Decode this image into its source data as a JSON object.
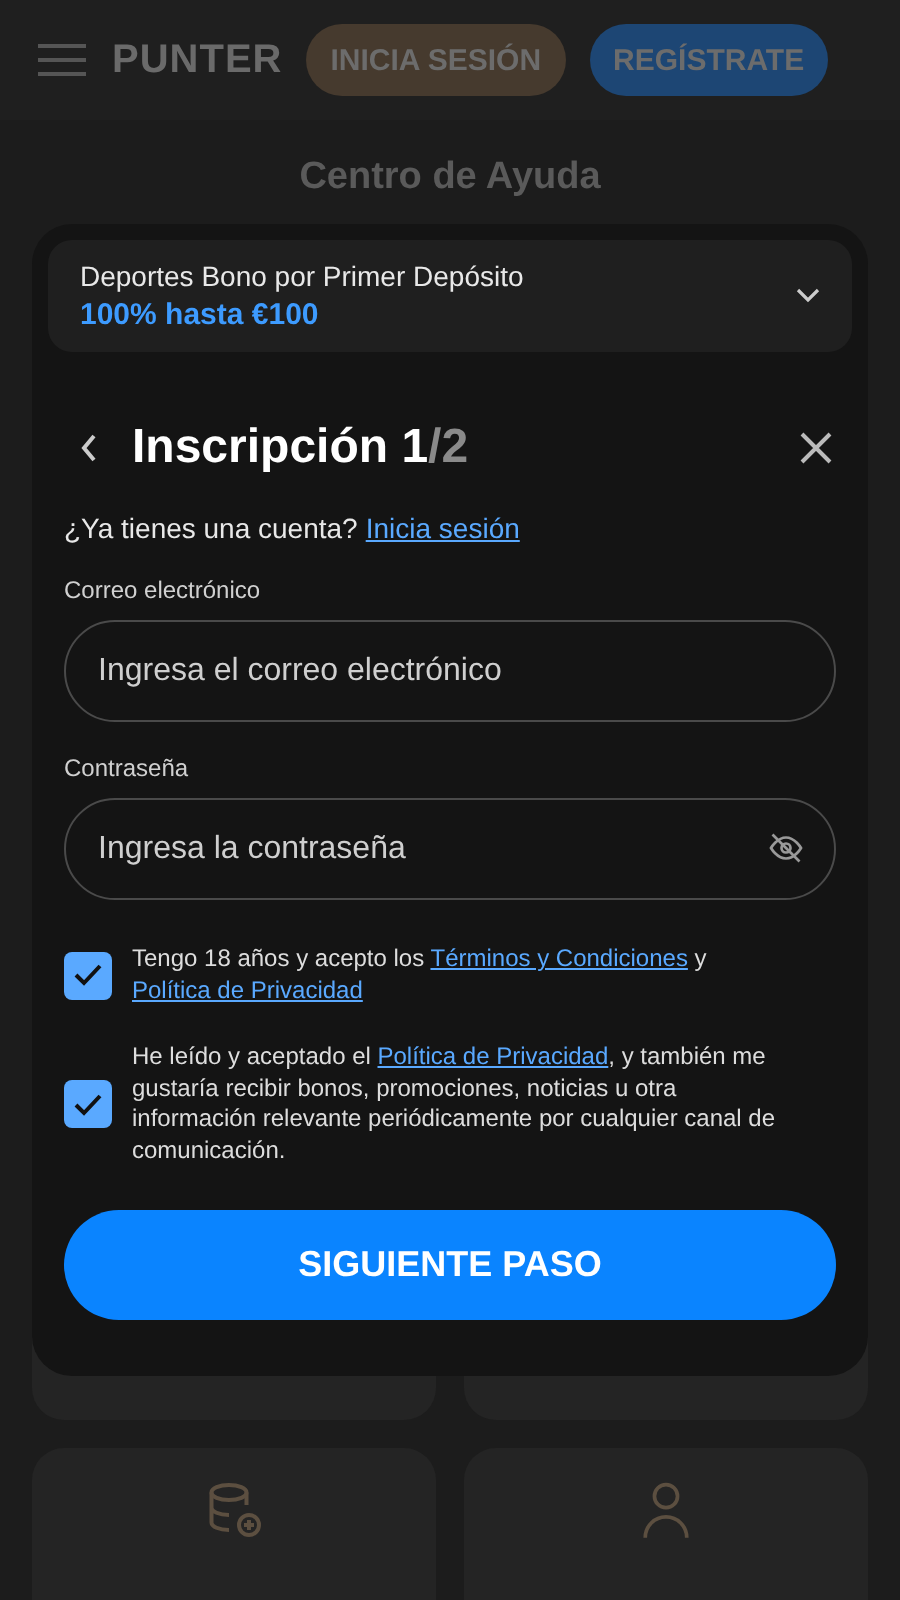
{
  "header": {
    "logo": "PUNTER",
    "login_button": "INICIA SESIÓN",
    "register_button": "REGÍSTRATE"
  },
  "page_title": "Centro de Ayuda",
  "cards": [
    {
      "kind": "covered"
    },
    {
      "kind": "covered"
    },
    {
      "kind": "deposit"
    },
    {
      "kind": "account"
    }
  ],
  "modal": {
    "bonus": {
      "title": "Deportes Bono por Primer Depósito",
      "offer": "100% hasta €100"
    },
    "title": "Inscripción 1",
    "step_total": "/2",
    "login_prompt": "¿Ya tienes una cuenta?",
    "login_link": "Inicia sesión",
    "fields": [
      {
        "label": "Correo electrónico",
        "placeholder": "Ingresa el correo electrónico",
        "kind": "email"
      },
      {
        "label": "Contraseña",
        "placeholder": "Ingresa la contraseña",
        "kind": "password"
      }
    ],
    "consents": [
      {
        "checked": true,
        "parts": [
          {
            "kind": "text",
            "text": "Tengo 18 años y acepto los "
          },
          {
            "kind": "link",
            "text": "Términos y Condiciones"
          },
          {
            "kind": "text",
            "text": " y "
          },
          {
            "kind": "link",
            "text": "Política de Privacidad"
          }
        ]
      },
      {
        "checked": true,
        "parts": [
          {
            "kind": "text",
            "text": "He leído y aceptado el "
          },
          {
            "kind": "link",
            "text": "Política de Privacidad"
          },
          {
            "kind": "text",
            "text": ", y también me gustaría recibir bonos, promociones, noticias u otra información relevante periódicamente por cualquier canal de comunicación."
          }
        ]
      }
    ],
    "submit": "SIGUIENTE PASO"
  }
}
